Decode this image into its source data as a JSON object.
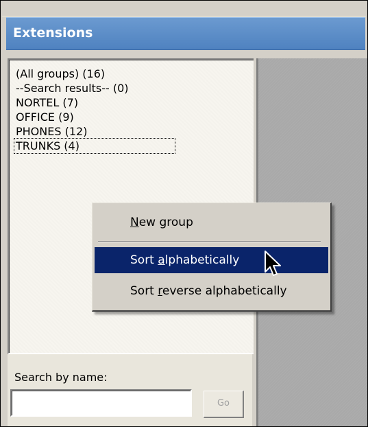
{
  "header": {
    "title": "Extensions"
  },
  "groups": [
    {
      "label": "(All groups) (16)",
      "focused": false
    },
    {
      "label": "--Search results-- (0)",
      "focused": false
    },
    {
      "label": "NORTEL (7)",
      "focused": false
    },
    {
      "label": "OFFICE (9)",
      "focused": false
    },
    {
      "label": "PHONES (12)",
      "focused": false
    },
    {
      "label": "TRUNKS (4)",
      "focused": true
    }
  ],
  "context_menu": {
    "items": [
      {
        "pre": "",
        "accel": "N",
        "post": "ew group",
        "highlighted": false
      },
      {
        "pre": "Sort ",
        "accel": "a",
        "post": "lphabetically",
        "highlighted": true
      },
      {
        "pre": "Sort ",
        "accel": "r",
        "post": "everse alphabetically",
        "highlighted": false
      }
    ]
  },
  "search": {
    "label": "Search by name:",
    "value": "",
    "go_label": "Go"
  },
  "colors": {
    "title_bar": "#5a8cc8",
    "highlight": "#0a246a",
    "dialog_face": "#d4d0c8"
  }
}
